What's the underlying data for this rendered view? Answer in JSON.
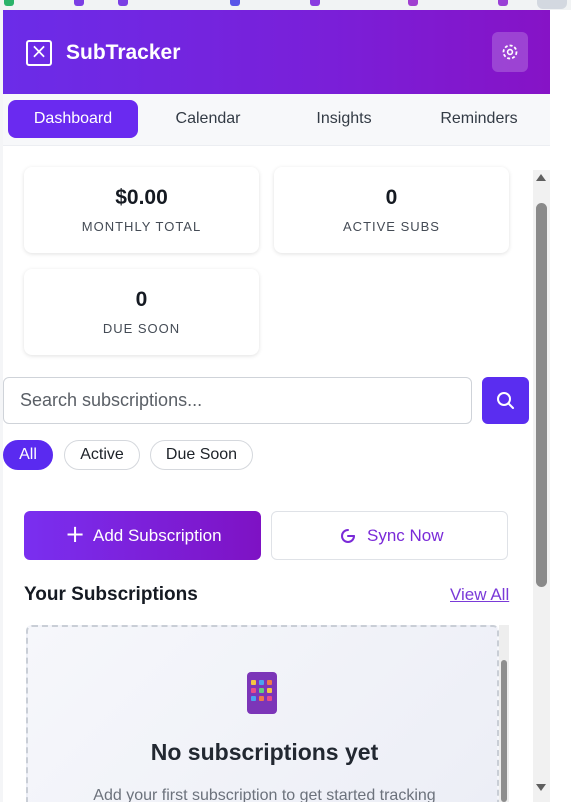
{
  "app": {
    "title": "SubTracker"
  },
  "header": {
    "settings_icon": "settings-icon"
  },
  "tabs": [
    {
      "label": "Dashboard",
      "active": true
    },
    {
      "label": "Calendar",
      "active": false
    },
    {
      "label": "Insights",
      "active": false
    },
    {
      "label": "Reminders",
      "active": false
    }
  ],
  "stats": {
    "monthly_total": {
      "value": "$0.00",
      "label": "MONTHLY TOTAL"
    },
    "active_subs": {
      "value": "0",
      "label": "ACTIVE SUBS"
    },
    "due_soon": {
      "value": "0",
      "label": "DUE SOON"
    }
  },
  "search": {
    "placeholder": "Search subscriptions...",
    "value": ""
  },
  "filters": [
    {
      "label": "All",
      "active": true
    },
    {
      "label": "Active",
      "active": false
    },
    {
      "label": "Due Soon",
      "active": false
    }
  ],
  "actions": {
    "add_label": "Add Subscription",
    "sync_label": "Sync Now"
  },
  "subscriptions": {
    "title": "Your Subscriptions",
    "view_all": "View All",
    "empty_title": "No subscriptions yet",
    "empty_subtitle": "Add your first subscription to get started tracking"
  },
  "colors": {
    "accent": "#6a2af0",
    "header_start": "#6b2ce8",
    "header_end": "#8613c6",
    "link": "#7a3ad8"
  }
}
